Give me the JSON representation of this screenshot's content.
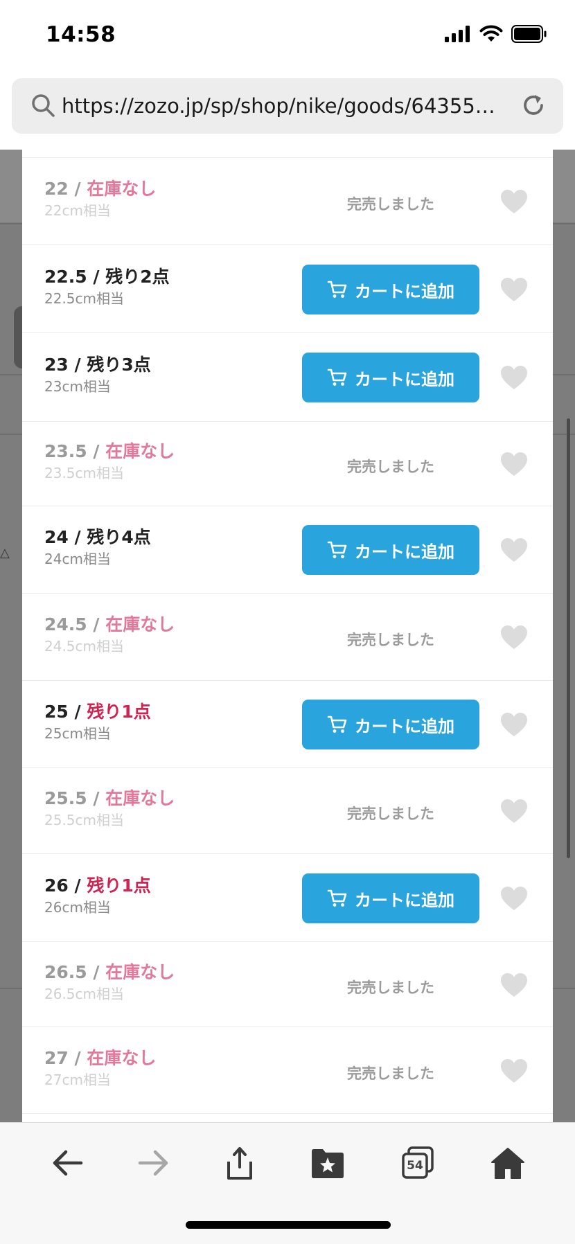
{
  "status_bar": {
    "time": "14:58"
  },
  "browser": {
    "url": "https://zozo.jp/sp/shop/nike/goods/64355…"
  },
  "size_list": {
    "rows": [
      {
        "size": "22",
        "stock": "在庫なし",
        "cm": "22cm相当",
        "status": "soldout",
        "action": "完売しました"
      },
      {
        "size": "22.5",
        "stock": "残り2点",
        "cm": "22.5cm相当",
        "status": "available",
        "action": "カートに追加"
      },
      {
        "size": "23",
        "stock": "残り3点",
        "cm": "23cm相当",
        "status": "available",
        "action": "カートに追加"
      },
      {
        "size": "23.5",
        "stock": "在庫なし",
        "cm": "23.5cm相当",
        "status": "soldout",
        "action": "完売しました"
      },
      {
        "size": "24",
        "stock": "残り4点",
        "cm": "24cm相当",
        "status": "available",
        "action": "カートに追加"
      },
      {
        "size": "24.5",
        "stock": "在庫なし",
        "cm": "24.5cm相当",
        "status": "soldout",
        "action": "完売しました"
      },
      {
        "size": "25",
        "stock": "残り1点",
        "cm": "25cm相当",
        "status": "low",
        "action": "カートに追加"
      },
      {
        "size": "25.5",
        "stock": "在庫なし",
        "cm": "25.5cm相当",
        "status": "soldout",
        "action": "完売しました"
      },
      {
        "size": "26",
        "stock": "残り1点",
        "cm": "26cm相当",
        "status": "low",
        "action": "カートに追加"
      },
      {
        "size": "26.5",
        "stock": "在庫なし",
        "cm": "26.5cm相当",
        "status": "soldout",
        "action": "完売しました"
      },
      {
        "size": "27",
        "stock": "在庫なし",
        "cm": "27cm相当",
        "status": "soldout",
        "action": "完売しました"
      }
    ]
  },
  "toolbar": {
    "tab_count": "54"
  },
  "colors": {
    "accent": "#2aa4dc",
    "stock_none": "#e2799a",
    "stock_low": "#cf2452",
    "soldout_text": "#9b9b9b"
  },
  "icons": [
    "search-icon",
    "reload-icon",
    "cart-icon",
    "heart-icon",
    "back-arrow-icon",
    "forward-arrow-icon",
    "share-icon",
    "bookmarks-icon",
    "tabs-icon",
    "home-icon"
  ]
}
